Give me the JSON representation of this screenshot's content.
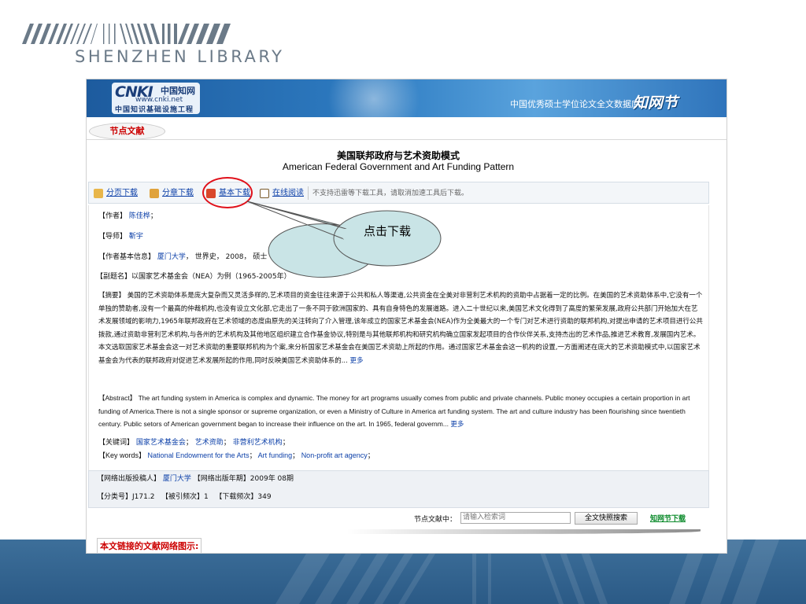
{
  "slide": {
    "library_name": "SHENZHEN LIBRARY"
  },
  "banner": {
    "logo_mark": "CNKI",
    "logo_cn": "中国知网",
    "logo_url": "www.cnki.net",
    "logo_slogan": "中国知识基础设施工程",
    "db_name": "中国优秀硕士学位论文全文数据库",
    "db_brand": "知网节"
  },
  "tab": {
    "label": "节点文献"
  },
  "article": {
    "title_cn": "美国联邦政府与艺术资助模式",
    "title_en": "American Federal Government and Art Funding Pattern"
  },
  "toolbar": {
    "page_download": "分页下载",
    "chapter_download": "分章下载",
    "basic_download": "基本下载",
    "online_read": "在线阅读",
    "note": "不支持迅雷等下载工具，请取消加速工具后下载。"
  },
  "callout": {
    "text": "点击下载"
  },
  "meta": {
    "author_label": "【作者】",
    "author": "陈佳桦",
    "advisor_label": "【导师】",
    "advisor": "靳宇",
    "basic_label": "【作者基本信息】",
    "university": "厦门大学",
    "basic_rest": "， 世界史， 2008， 硕士",
    "subtitle": "【副题名】以国家艺术基金会（NEA）为例（1965-2005年）"
  },
  "abstract_cn": {
    "label": "【摘要】",
    "text": "美国的艺术资助体系是庞大复杂而又灵活多样的,艺术项目的资金往往来源于公共和私人等渠道,公共资金在全美对非营利艺术机构的资助中占据着一定的比例。在美国的艺术资助体系中,它没有一个单独的赞助者,没有一个最高的仲裁机构,也没有设立文化部,它走出了一条不同于欧洲国家的、具有自身特色的发展道路。进入二十世纪以来,美国艺术文化得到了高度的繁荣发展,政府公共部门开始加大在艺术发展领域的影响力,1965年联邦政府在艺术领域的态度由原先的关注转向了介入管理,该年成立的国家艺术基金会(NEA)作为全美最大的一个专门对艺术进行资助的联邦机构,对提出申请的艺术项目进行公共拨款,通过资助非营利艺术机构,与各州的艺术机构及其他地区组织建立合作基金协议,特别是与其他联邦机构和研究机构确立国家发起项目的合作伙伴关系,支持杰出的艺术作品,推进艺术教育,发展国内艺术。本文选取国家艺术基金会这一对艺术资助的重要联邦机构为个案,来分析国家艺术基金会在美国艺术资助上所起的作用。通过国家艺术基金会这一机构的设置,一方面阐述在庞大的艺术资助模式中,以国家艺术基金会为代表的联邦政府对促进艺术发展所起的作用,同时反映美国艺术资助体系的...",
    "more": "更多"
  },
  "abstract_en": {
    "label": "【Abstract】",
    "text": "The art funding system in America is complex and dynamic. The money for art programs usually comes from public and private channels. Public money occupies a certain proportion in art funding of America.There is not a single sponsor or supreme organization, or even a Ministry of Culture in America art funding system. The art and culture industry has been flourishing since twentieth century. Public setors of American government began to increase their influence on the art. In 1965, federal governm...",
    "more": "更多"
  },
  "keywords": {
    "cn_label": "【关键词】",
    "cn": [
      "国家艺术基金会",
      "艺术资助",
      "非营利艺术机构"
    ],
    "en_label": "【Key words】",
    "en": [
      "National Endowment for the Arts",
      "Art funding",
      "Non-profit art agency"
    ]
  },
  "publish": {
    "unit_label": "【网络出版投稿人】",
    "unit": "厦门大学",
    "date_label": "【网络出版年期】",
    "date": "2009年 08期",
    "class_label": "【分类号】",
    "class": "J171.2",
    "cited_label": "【被引频次】",
    "cited": "1",
    "download_label": "【下载频次】",
    "downloads": "349"
  },
  "search": {
    "label": "节点文献中：",
    "placeholder": "请输入检索词",
    "button": "全文快照搜索",
    "node_download": "知网节下载"
  },
  "network": {
    "label": "本文链接的文献网络图示:"
  },
  "colors": {
    "banner": "#2e7cc2",
    "link": "#0b3fa8",
    "highlight": "#e0101a",
    "callout_fill": "#c9e4e6",
    "band": "#2b5a86"
  }
}
